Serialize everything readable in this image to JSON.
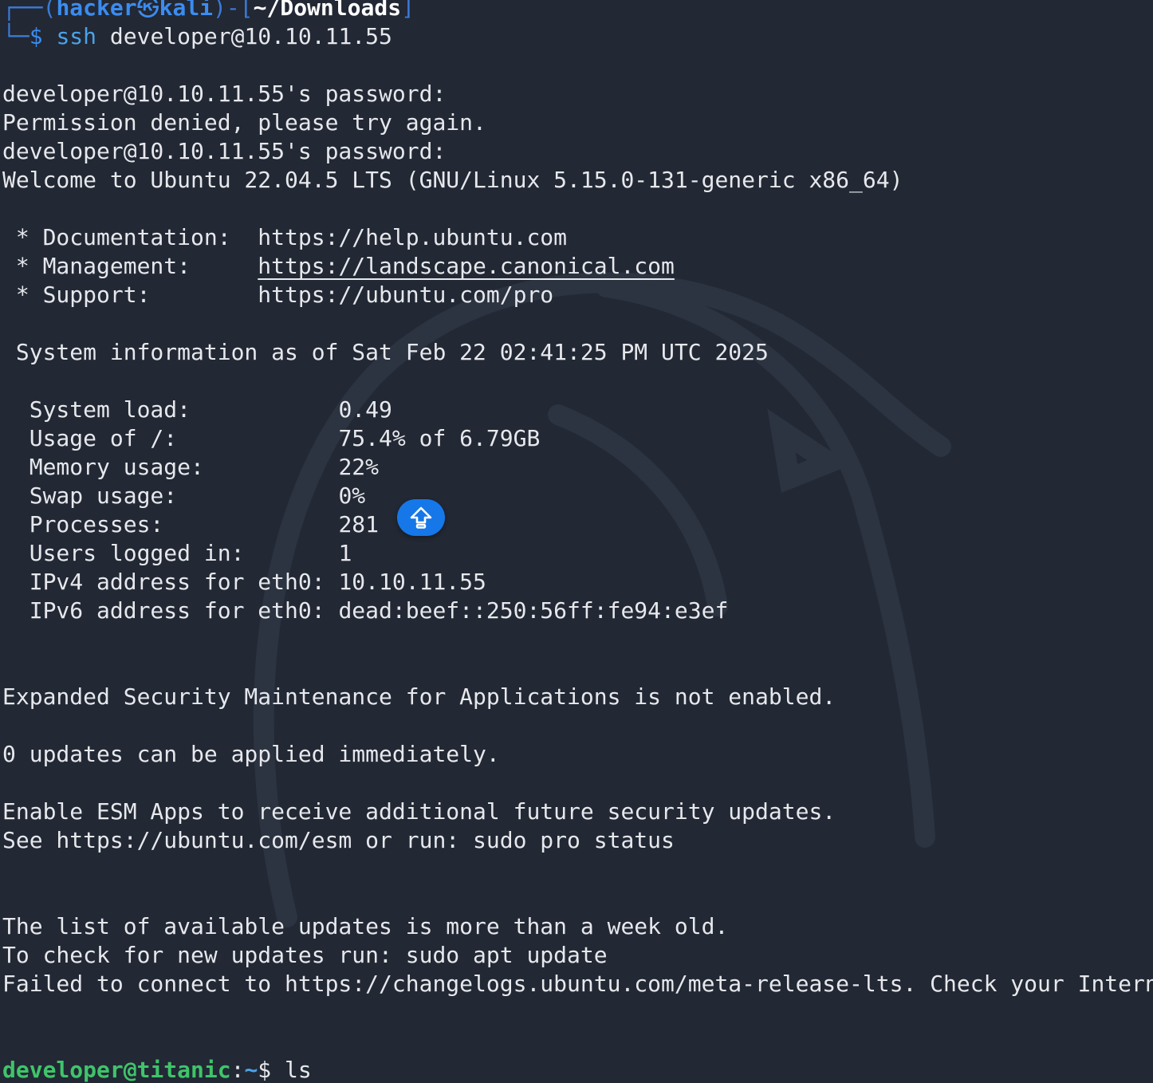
{
  "prompt": {
    "frame_top": "┌──(",
    "user": "hacker",
    "skull": "㉿",
    "host": "kali",
    "sep": ")-[",
    "dir": "~/Downloads",
    "close": "]",
    "frame_bottom": "└─",
    "dollar": "$",
    "cmd_bin": "ssh",
    "cmd_args": " developer@10.10.11.55"
  },
  "output": {
    "pw1": "developer@10.10.11.55's password:",
    "denied": "Permission denied, please try again.",
    "pw2": "developer@10.10.11.55's password:",
    "welcome": "Welcome to Ubuntu 22.04.5 LTS (GNU/Linux 5.15.0-131-generic x86_64)",
    "doc_label": " * Documentation:  ",
    "doc_url": "https://help.ubuntu.com",
    "mgmt_label": " * Management:     ",
    "mgmt_url": "https://landscape.canonical.com",
    "support_label": " * Support:        ",
    "support_url": "https://ubuntu.com/pro",
    "sysinfo": " System information as of Sat Feb 22 02:41:25 PM UTC 2025",
    "stats": [
      {
        "label": "  System load:           ",
        "value": "0.49"
      },
      {
        "label": "  Usage of /:            ",
        "value": "75.4% of 6.79GB"
      },
      {
        "label": "  Memory usage:          ",
        "value": "22%"
      },
      {
        "label": "  Swap usage:            ",
        "value": "0%"
      },
      {
        "label": "  Processes:             ",
        "value": "281"
      },
      {
        "label": "  Users logged in:       ",
        "value": "1"
      },
      {
        "label": "  IPv4 address for eth0: ",
        "value": "10.10.11.55"
      },
      {
        "label": "  IPv6 address for eth0: ",
        "value": "dead:beef::250:56ff:fe94:e3ef"
      }
    ],
    "esm": "Expanded Security Maintenance for Applications is not enabled.",
    "updates": "0 updates can be applied immediately.",
    "enable_esm": "Enable ESM Apps to receive additional future security updates.",
    "see_esm": "See https://ubuntu.com/esm or run: sudo pro status",
    "list_old": "The list of available updates is more than a week old.",
    "check_new": "To check for new updates run: sudo apt update",
    "failed": "Failed to connect to https://changelogs.ubuntu.com/meta-release-lts. Check your Internet co"
  },
  "remote_prompt": {
    "user_host": "developer@titanic",
    "colon": ":",
    "path": "~",
    "dollar": "$ ",
    "command": "ls"
  },
  "overlay": {
    "icon": "shift-up-arrow-icon",
    "color": "#1677e8"
  }
}
